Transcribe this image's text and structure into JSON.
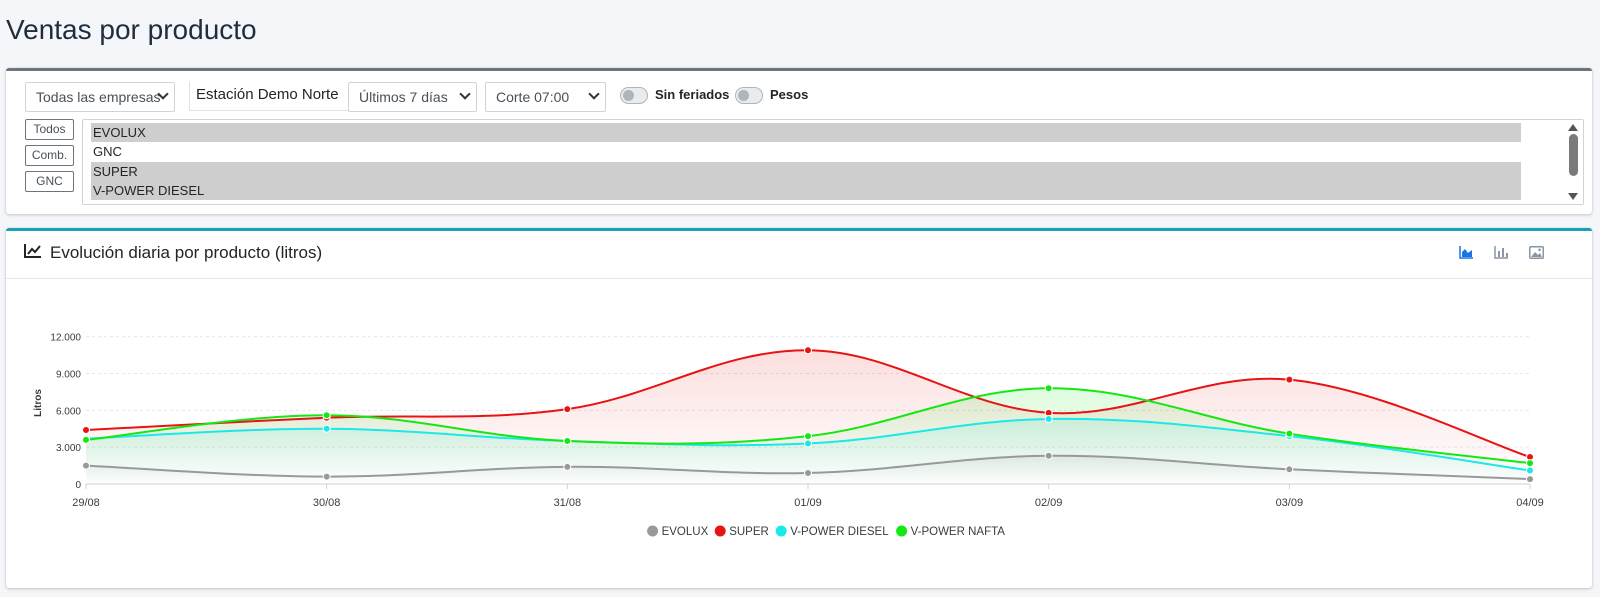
{
  "page": {
    "title": "Ventas por producto"
  },
  "filters": {
    "company_select": "Todas las empresas",
    "station": "Estación Demo Norte",
    "period_select": "Últimos 7 días",
    "cutoff_select": "Corte 07:00",
    "toggle_holidays": "Sin feriados",
    "toggle_pesos": "Pesos",
    "quick_buttons": [
      "Todos",
      "Comb.",
      "GNC"
    ],
    "products": [
      {
        "label": "EVOLUX",
        "selected": true
      },
      {
        "label": "GNC",
        "selected": false
      },
      {
        "label": "SUPER",
        "selected": true
      },
      {
        "label": "V-POWER DIESEL",
        "selected": true
      }
    ]
  },
  "chart_card": {
    "title": "Evolución diaria por producto (litros)",
    "icons": [
      "area-chart-icon",
      "bar-chart-icon",
      "image-icon"
    ]
  },
  "chart_data": {
    "type": "line",
    "smooth": true,
    "area_fill": true,
    "ylabel": "Litros",
    "xlabel": "",
    "ylim": [
      0,
      13200
    ],
    "y_ticks": [
      0,
      3000,
      6000,
      9000,
      12000
    ],
    "y_tick_labels": [
      "0",
      "3.000",
      "6.000",
      "9.000",
      "12.000"
    ],
    "categories": [
      "29/08",
      "30/08",
      "31/08",
      "01/09",
      "02/09",
      "03/09",
      "04/09"
    ],
    "grid": true,
    "legend_position": "bottom-center",
    "series": [
      {
        "name": "EVOLUX",
        "color": "#999999",
        "values": [
          1500,
          600,
          1400,
          900,
          2300,
          1200,
          400
        ]
      },
      {
        "name": "SUPER",
        "color": "#e81313",
        "values": [
          4400,
          5400,
          6100,
          10900,
          5800,
          8500,
          2200
        ]
      },
      {
        "name": "V-POWER DIESEL",
        "color": "#1be8e8",
        "values": [
          3700,
          4500,
          3500,
          3300,
          5300,
          3900,
          1100
        ]
      },
      {
        "name": "V-POWER NAFTA",
        "color": "#13e813",
        "values": [
          3600,
          5600,
          3500,
          3900,
          7800,
          4100,
          1700
        ]
      }
    ]
  }
}
